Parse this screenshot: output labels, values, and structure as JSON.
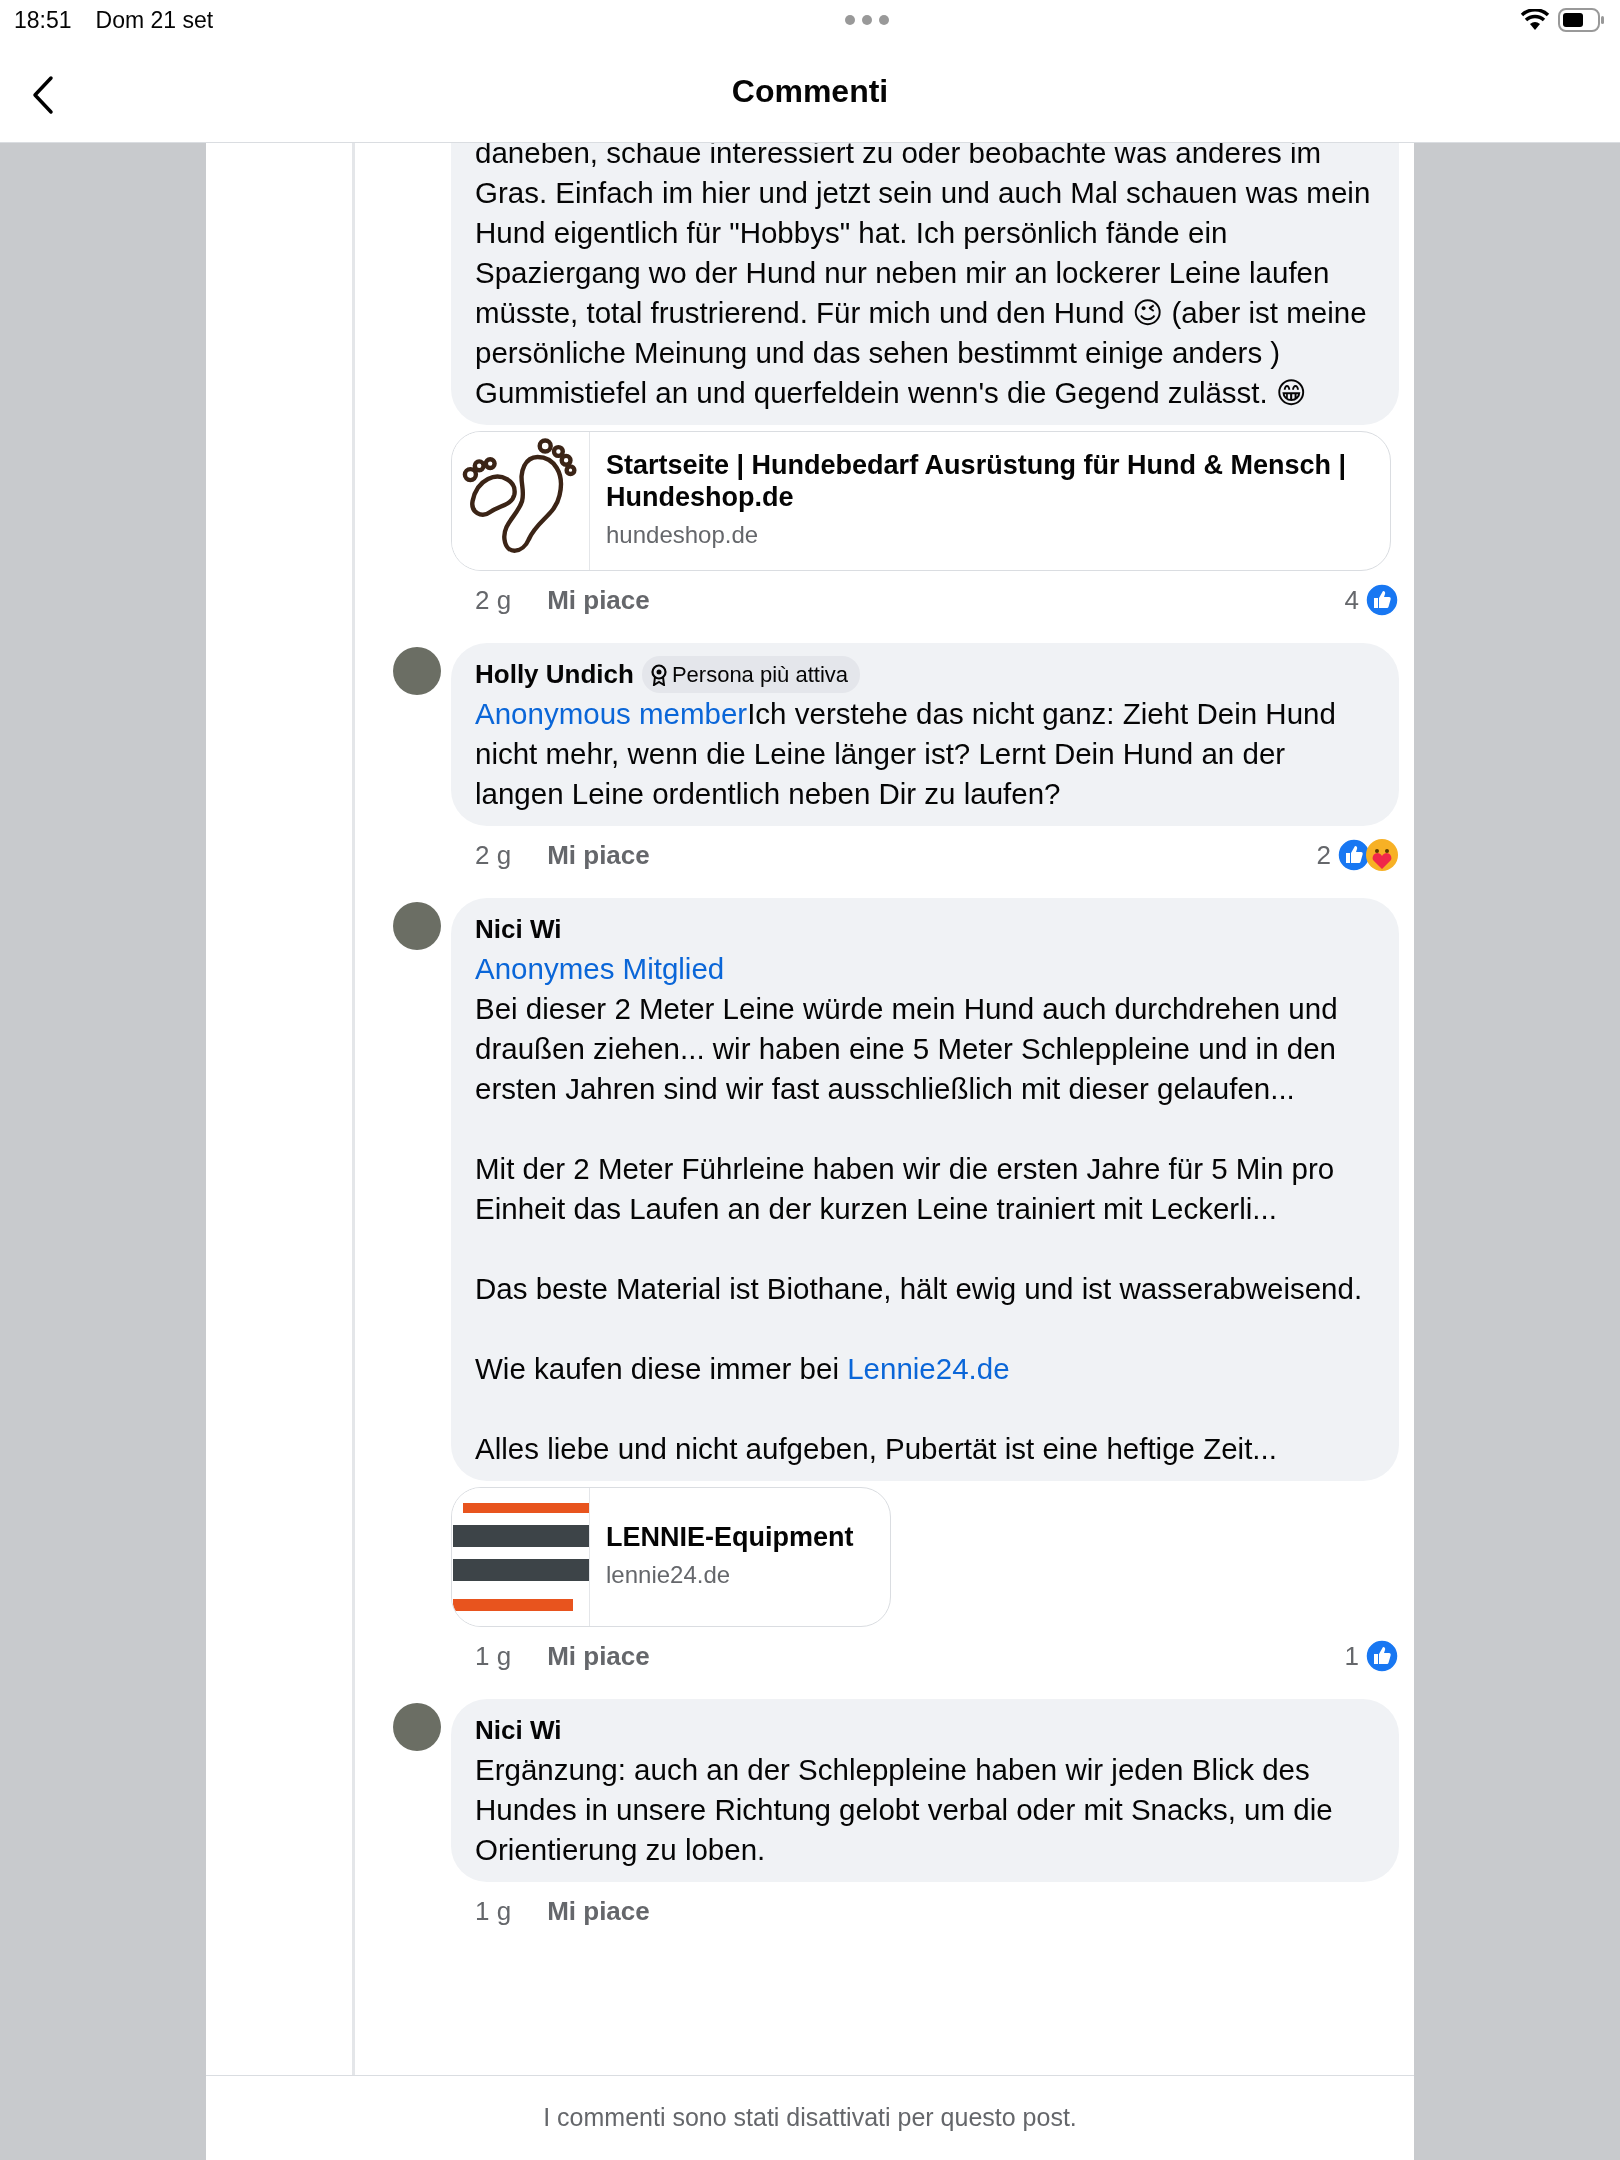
{
  "status_bar": {
    "time": "18:51",
    "date": "Dom 21 set"
  },
  "header": {
    "title": "Commenti"
  },
  "comments": [
    {
      "paragraphs": [
        {
          "text": "daneben, schaue interessiert zu oder beobachte was anderes im Gras. Einfach im hier und jetzt sein und auch Mal schauen was mein Hund eigentlich für \"Hobbys\" hat. Ich persönlich fände ein Spaziergang wo der Hund nur neben mir an lockerer Leine laufen müsste, total frustrierend. Für mich und den Hund 😉 (aber ist meine persönliche Meinung und das sehen bestimmt einige anders )\nGummistiefel an und querfeldein wenn's die Gegend zulässt. 😁"
        }
      ],
      "link_preview": {
        "kind": "paws",
        "title": "Startseite | Hundebedarf Ausrüstung für Hund & Mensch | Hundeshop.de",
        "domain": "hundeshop.de"
      },
      "time": "2 g",
      "like_label": "Mi piace",
      "reaction_count": "4",
      "reactions": [
        {
          "kind": "like"
        }
      ]
    },
    {
      "author": "Holly Undich",
      "badge": "Persona più attiva",
      "mention": {
        "text": "Anonymous member",
        "kind": "inline"
      },
      "paragraphs": [
        {
          "text": "Ich verstehe das nicht ganz: Zieht Dein Hund nicht mehr, wenn die Leine länger ist? Lernt Dein Hund an der langen Leine ordentlich neben Dir zu laufen?"
        }
      ],
      "time": "2 g",
      "like_label": "Mi piace",
      "reaction_count": "2",
      "reactions": [
        {
          "kind": "like"
        },
        {
          "kind": "care"
        }
      ]
    },
    {
      "author": "Nici Wi",
      "mention": {
        "text": "Anonymes Mitglied",
        "kind": "block"
      },
      "paragraphs": [
        {
          "text": "Bei dieser 2 Meter Leine würde mein Hund auch durchdrehen und draußen ziehen... wir haben eine 5 Meter Schleppleine und in den ersten Jahren sind wir fast ausschließlich mit dieser gelaufen..."
        },
        {
          "text": "Mit der 2 Meter Führleine haben wir die ersten Jahre für 5 Min pro Einheit das Laufen an der kurzen Leine trainiert mit Leckerli..."
        },
        {
          "text": "Das beste Material ist Biothane, hält ewig und ist wasserabweisend."
        },
        {
          "text": "Wie kaufen diese immer bei ",
          "link": "Lennie24.de"
        },
        {
          "text": "Alles liebe und nicht aufgeben, Pubertät ist eine heftige Zeit..."
        }
      ],
      "link_preview": {
        "kind": "logo",
        "title": "LENNIE-Equipment",
        "domain": "lennie24.de"
      },
      "time": "1 g",
      "like_label": "Mi piace",
      "reaction_count": "1",
      "reactions": [
        {
          "kind": "like"
        }
      ]
    },
    {
      "author": "Nici Wi",
      "paragraphs": [
        {
          "text": "Ergänzung: auch an der Schleppleine haben wir jeden Blick des Hundes in unsere Richtung gelobt verbal oder mit Snacks, um die Orientierung zu loben."
        }
      ],
      "time": "1 g",
      "like_label": "Mi piace"
    }
  ],
  "footer": {
    "notice": "I commenti sono stati disattivati per questo post."
  }
}
